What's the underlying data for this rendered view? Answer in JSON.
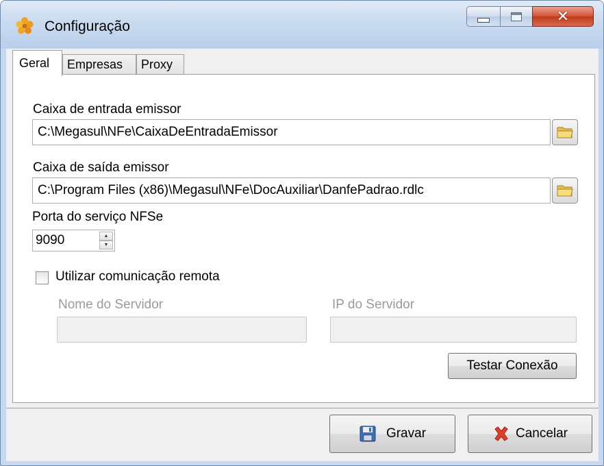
{
  "window": {
    "title": "Configuração"
  },
  "tabs": [
    {
      "label": "Geral",
      "active": true
    },
    {
      "label": "Empresas",
      "active": false
    },
    {
      "label": "Proxy",
      "active": false
    }
  ],
  "geral": {
    "inbox_label": "Caixa de entrada emissor",
    "inbox_value": "C:\\Megasul\\NFe\\CaixaDeEntradaEmissor",
    "outbox_label": "Caixa de saída emissor",
    "outbox_value": "C:\\Program Files (x86)\\Megasul\\NFe\\DocAuxiliar\\DanfePadrao.rdlc",
    "port_label": "Porta do serviço NFSe",
    "port_value": "9090",
    "remote_label": "Utilizar comunicação remota",
    "remote_checked": false,
    "server_name_label": "Nome do Servidor",
    "server_name_value": "",
    "server_ip_label": "IP do Servidor",
    "server_ip_value": "",
    "test_button": "Testar Conexão"
  },
  "footer": {
    "save_button": "Gravar",
    "cancel_button": "Cancelar"
  },
  "icons": {
    "app": "flower-icon",
    "folder": "folder-icon",
    "save": "floppy-disk-icon",
    "cancel": "red-x-icon"
  },
  "colors": {
    "titlebar": "#c9dbf0",
    "close_button": "#d5543a",
    "client_bg": "#f0f0f0"
  }
}
